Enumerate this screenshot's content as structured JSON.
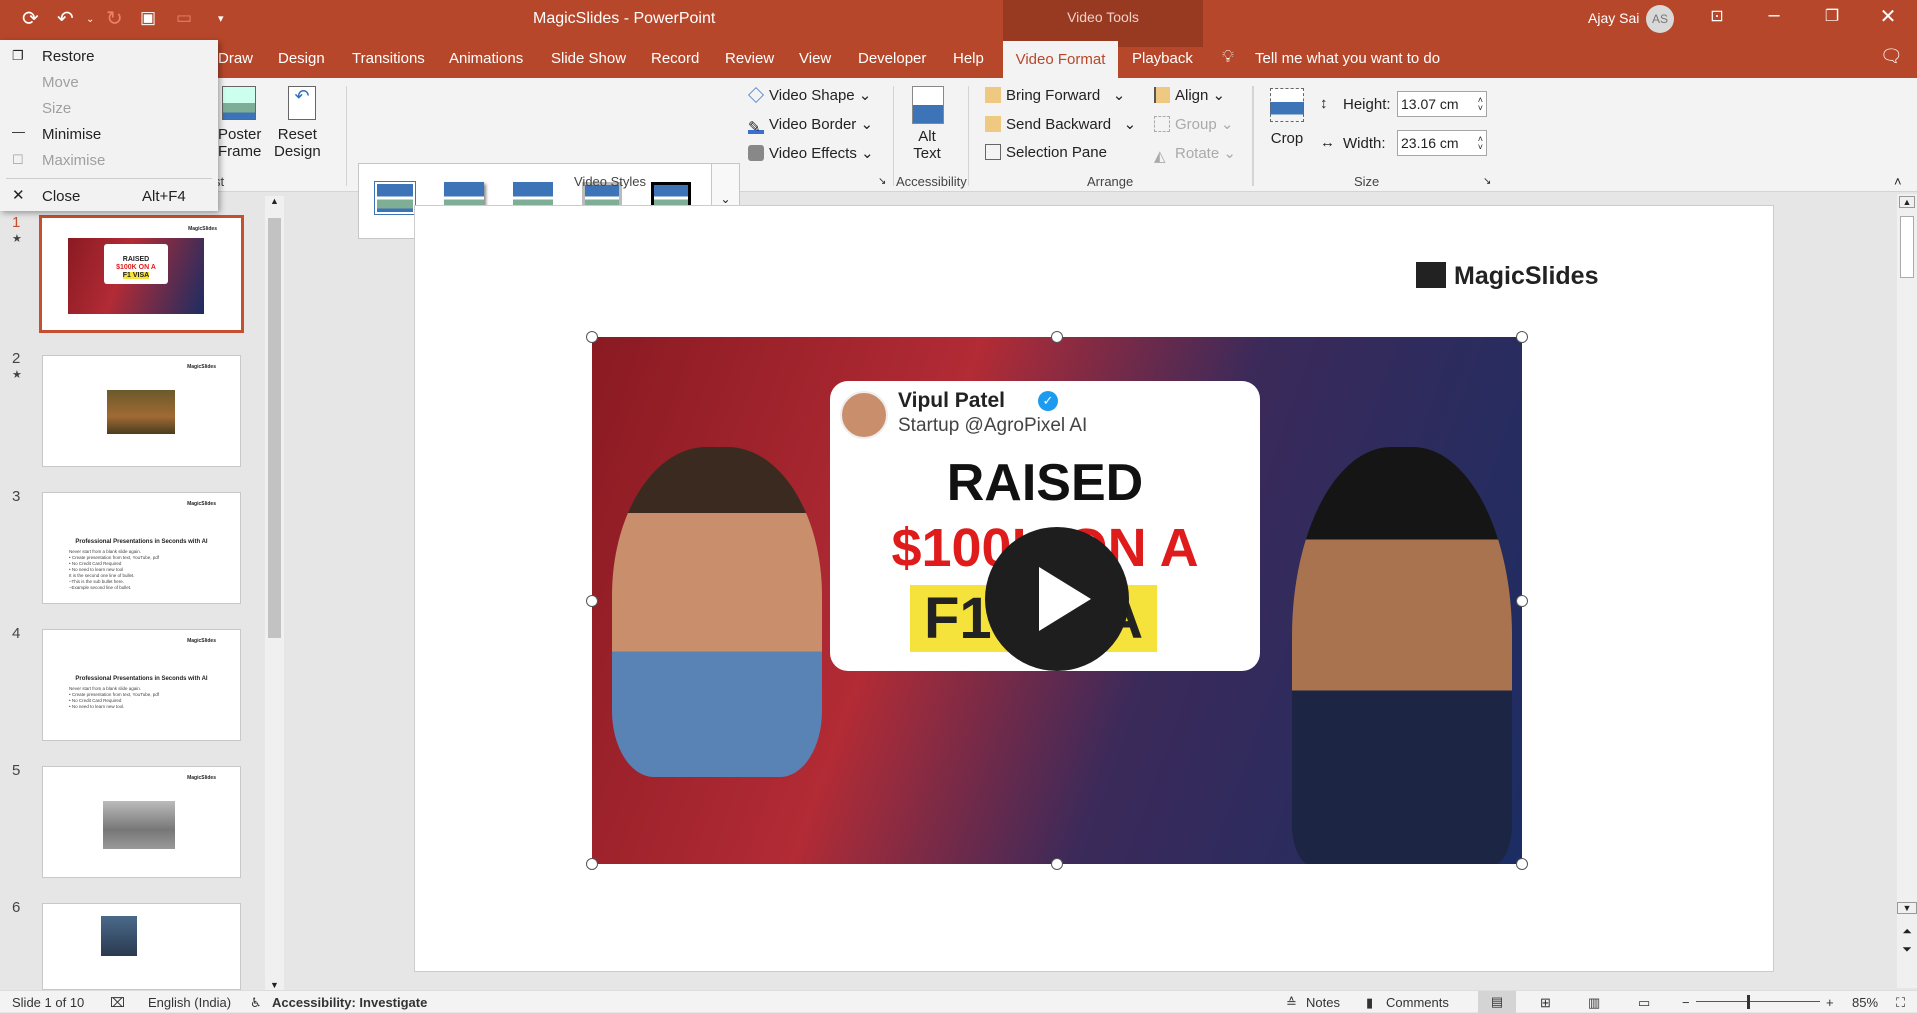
{
  "window": {
    "title": "MagicSlides  -  PowerPoint",
    "context_tab_group": "Video Tools",
    "user_name": "Ajay Sai",
    "user_initials": "AS"
  },
  "tabs": [
    {
      "label": "Draw"
    },
    {
      "label": "Design"
    },
    {
      "label": "Transitions"
    },
    {
      "label": "Animations"
    },
    {
      "label": "Slide Show"
    },
    {
      "label": "Record"
    },
    {
      "label": "Review"
    },
    {
      "label": "View"
    },
    {
      "label": "Developer"
    },
    {
      "label": "Help"
    },
    {
      "label": "Video Format",
      "active": true
    },
    {
      "label": "Playback"
    }
  ],
  "tell_me": "Tell me what you want to do",
  "ribbon": {
    "adjust": {
      "poster_frame": [
        "Poster",
        "Frame"
      ],
      "reset_design": [
        "Reset",
        "Design"
      ],
      "label_partial": "st"
    },
    "video_styles": {
      "label": "Video Styles",
      "video_shape": "Video Shape",
      "video_border": "Video Border",
      "video_effects": "Video Effects"
    },
    "accessibility": {
      "alt_text": [
        "Alt",
        "Text"
      ],
      "label": "Accessibility"
    },
    "arrange": {
      "label": "Arrange",
      "bring_forward": "Bring Forward",
      "send_backward": "Send Backward",
      "selection_pane": "Selection Pane",
      "align": "Align",
      "group": "Group",
      "rotate": "Rotate"
    },
    "size": {
      "label": "Size",
      "crop": "Crop",
      "height_label": "Height:",
      "height_value": "13.07 cm",
      "width_label": "Width:",
      "width_value": "23.16 cm"
    }
  },
  "system_menu": {
    "items": [
      {
        "label": "Restore",
        "enabled": true
      },
      {
        "label": "Move",
        "enabled": false
      },
      {
        "label": "Size",
        "enabled": false
      },
      {
        "label": "Minimise",
        "enabled": true
      },
      {
        "label": "Maximise",
        "enabled": false
      },
      {
        "label": "Close",
        "shortcut": "Alt+F4",
        "enabled": true
      }
    ]
  },
  "thumbnails": [
    {
      "num": "1",
      "star": "★",
      "logo": "MagicSlides"
    },
    {
      "num": "2",
      "star": "★",
      "logo": "MagicSlides"
    },
    {
      "num": "3",
      "logo": "MagicSlides",
      "title": "Professional Presentations in Seconds with AI",
      "lines": [
        "Never start from a blank slide again.",
        "• Create presentation from text, YouTube, pdf",
        "• No Credit Card Required",
        "• No need to learn new tool",
        "It is the second one line of bullet.",
        "   –This is the sub bullet here.",
        "   –Example second line of bullet."
      ]
    },
    {
      "num": "4",
      "logo": "MagicSlides",
      "title": "Professional Presentations in Seconds with AI",
      "lines": [
        "Never start from a blank slide again.",
        "• Create presentation from text, YouTube, pdf",
        "• No Credit Card Required",
        "• No need to learn new tool."
      ]
    },
    {
      "num": "5",
      "logo": "MagicSlides"
    },
    {
      "num": "6",
      "logo": ""
    }
  ],
  "slide": {
    "logo": "MagicSlides",
    "video": {
      "name": "Vipul Patel",
      "handle": "Startup @AgroPixel AI",
      "line1": "RAISED",
      "line2": "$100K ON A",
      "line3": "F1 VISA"
    }
  },
  "status": {
    "slide": "Slide 1 of 10",
    "language": "English (India)",
    "accessibility": "Accessibility: Investigate",
    "notes": "Notes",
    "comments": "Comments",
    "zoom": "85%",
    "zoom_level_percent": 85
  },
  "colors": {
    "accent": "#b7472a",
    "context_tab": "#983a21"
  }
}
